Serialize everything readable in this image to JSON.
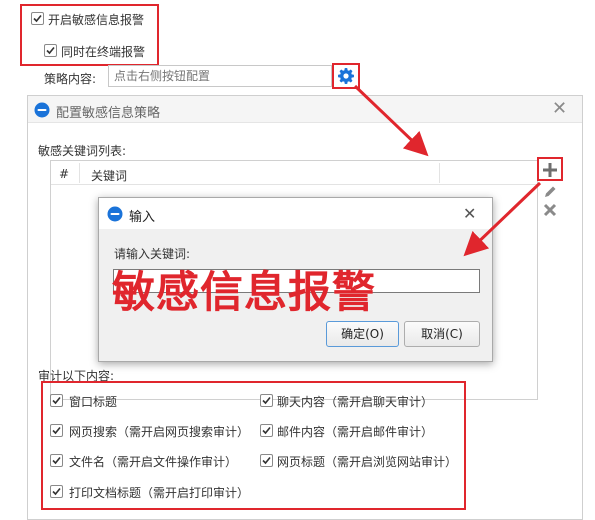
{
  "top_section": {
    "enable_alert_label": "开启敏感信息报警",
    "terminal_alert_label": "同时在终端报警",
    "strategy_label": "策略内容:",
    "strategy_placeholder": "点击右侧按钮配置",
    "enable_alert_checked": true,
    "terminal_alert_checked": true
  },
  "dialog": {
    "title": "配置敏感信息策略",
    "keyword_list_label": "敏感关键词列表:",
    "columns": [
      "#",
      "关键词"
    ],
    "audit_label": "审计以下内容:",
    "audit_items": [
      {
        "label": "窗口标题",
        "checked": true
      },
      {
        "label": "聊天内容（需开启聊天审计）",
        "checked": true
      },
      {
        "label": "网页搜索（需开启网页搜索审计）",
        "checked": true
      },
      {
        "label": "邮件内容（需开启邮件审计）",
        "checked": true
      },
      {
        "label": "文件名（需开启文件操作审计）",
        "checked": true
      },
      {
        "label": "网页标题（需开启浏览网站审计）",
        "checked": true
      },
      {
        "label": "打印文档标题（需开启打印审计）",
        "checked": true
      }
    ]
  },
  "input_dialog": {
    "title": "输入",
    "prompt": "请输入关键词:",
    "value": "敏感信息报警",
    "ok_label": "确定(O)",
    "cancel_label": "取消(C)"
  },
  "colors": {
    "annotation_red": "#e0262d",
    "accent_blue": "#1a73d9"
  }
}
